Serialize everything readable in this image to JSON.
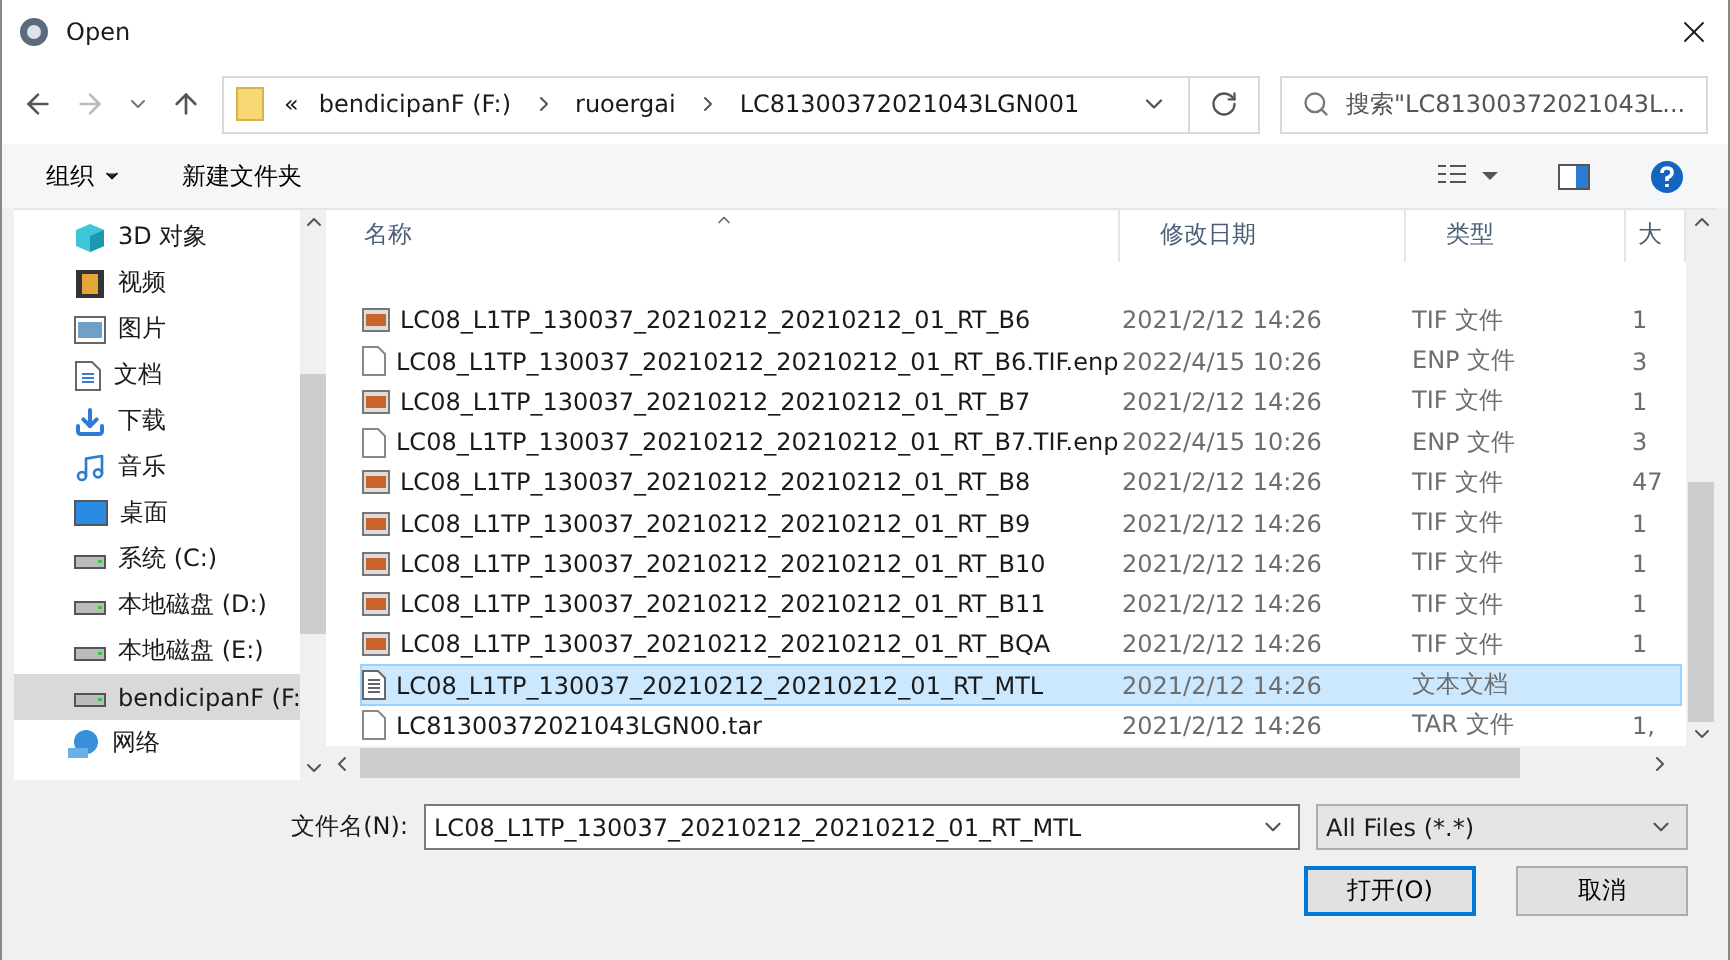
{
  "window": {
    "title": "Open"
  },
  "nav": {
    "path": [
      {
        "label": "«"
      },
      {
        "label": "bendicipanF (F:)"
      },
      {
        "label": "ruoergai"
      },
      {
        "label": "LC81300372021043LGN001"
      }
    ],
    "search": {
      "placeholder": "搜索\"LC81300372021043L..."
    }
  },
  "toolbar": {
    "organize": "组织",
    "new_folder": "新建文件夹"
  },
  "sidebar": {
    "items": [
      {
        "label": "3D 对象",
        "kind": "cube",
        "selected": false
      },
      {
        "label": "视频",
        "kind": "video",
        "selected": false
      },
      {
        "label": "图片",
        "kind": "image",
        "selected": false
      },
      {
        "label": "文档",
        "kind": "doc",
        "selected": false
      },
      {
        "label": "下载",
        "kind": "download",
        "selected": false
      },
      {
        "label": "音乐",
        "kind": "music",
        "selected": false
      },
      {
        "label": "桌面",
        "kind": "desktop",
        "selected": false
      },
      {
        "label": "系统 (C:)",
        "kind": "drive",
        "selected": false
      },
      {
        "label": "本地磁盘 (D:)",
        "kind": "drive",
        "selected": false
      },
      {
        "label": "本地磁盘 (E:)",
        "kind": "drive",
        "selected": false
      },
      {
        "label": "bendicipanF (F:",
        "kind": "drive",
        "selected": true
      },
      {
        "label": "网络",
        "kind": "network",
        "selected": false
      }
    ]
  },
  "table": {
    "columns": [
      "名称",
      "修改日期",
      "类型",
      "大"
    ],
    "rows": [
      {
        "name": "LC08_L1TP_130037_20210212_20210212_01_RT_B6",
        "kind": "image",
        "date": "2021/2/12 14:26",
        "type": "TIF 文件",
        "size": "1",
        "selected": false
      },
      {
        "name": "LC08_L1TP_130037_20210212_20210212_01_RT_B6.TIF.enp",
        "kind": "file",
        "date": "2022/4/15 10:26",
        "type": "ENP 文件",
        "size": "3",
        "selected": false
      },
      {
        "name": "LC08_L1TP_130037_20210212_20210212_01_RT_B7",
        "kind": "image",
        "date": "2021/2/12 14:26",
        "type": "TIF 文件",
        "size": "1",
        "selected": false
      },
      {
        "name": "LC08_L1TP_130037_20210212_20210212_01_RT_B7.TIF.enp",
        "kind": "file",
        "date": "2022/4/15 10:26",
        "type": "ENP 文件",
        "size": "3",
        "selected": false
      },
      {
        "name": "LC08_L1TP_130037_20210212_20210212_01_RT_B8",
        "kind": "image",
        "date": "2021/2/12 14:26",
        "type": "TIF 文件",
        "size": "47",
        "selected": false
      },
      {
        "name": "LC08_L1TP_130037_20210212_20210212_01_RT_B9",
        "kind": "image",
        "date": "2021/2/12 14:26",
        "type": "TIF 文件",
        "size": "1",
        "selected": false
      },
      {
        "name": "LC08_L1TP_130037_20210212_20210212_01_RT_B10",
        "kind": "image",
        "date": "2021/2/12 14:26",
        "type": "TIF 文件",
        "size": "1",
        "selected": false
      },
      {
        "name": "LC08_L1TP_130037_20210212_20210212_01_RT_B11",
        "kind": "image",
        "date": "2021/2/12 14:26",
        "type": "TIF 文件",
        "size": "1",
        "selected": false
      },
      {
        "name": "LC08_L1TP_130037_20210212_20210212_01_RT_BQA",
        "kind": "image",
        "date": "2021/2/12 14:26",
        "type": "TIF 文件",
        "size": "1",
        "selected": false
      },
      {
        "name": "LC08_L1TP_130037_20210212_20210212_01_RT_MTL",
        "kind": "text",
        "date": "2021/2/12 14:26",
        "type": "文本文档",
        "selected": true
      },
      {
        "name": "LC81300372021043LGN00.tar",
        "kind": "file",
        "date": "2021/2/12 14:26",
        "type": "TAR 文件",
        "size": "1,",
        "selected": false
      }
    ]
  },
  "footer": {
    "filename_label": "文件名(N):",
    "filename": "LC08_L1TP_130037_20210212_20210212_01_RT_MTL",
    "filter": "All Files (*.*)",
    "open": "打开(O)",
    "cancel": "取消"
  }
}
